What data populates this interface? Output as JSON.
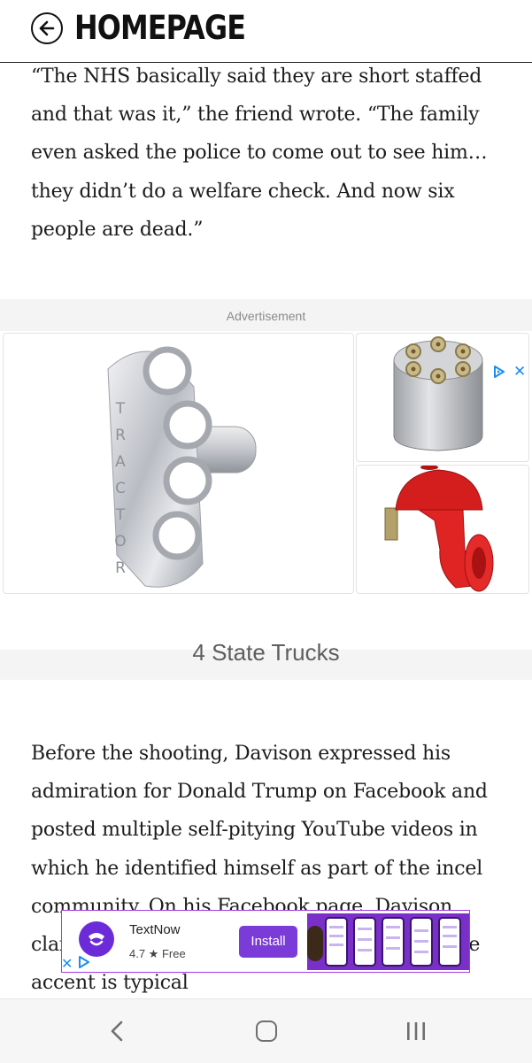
{
  "header": {
    "back_icon": "arrow-left-circle-icon",
    "title": "HOMEPAGE"
  },
  "article": {
    "paragraph_1": "“The NHS basically said they are short staffed and that was it,” the friend wrote. “The family even asked the police to come out to see him… they didn’t do a welfare check. And now six people are dead.”",
    "paragraph_2": "Before the shooting, Davison expressed his admiration for Donald Trump on Facebook and posted multiple self-pitying YouTube videos in which he identified himself as part of the incel community. On his Facebook page, Davison claimed to be from Arizona, but his distinctive accent is typical"
  },
  "ad": {
    "label": "Advertisement",
    "brand": "4 State Trucks",
    "main_image_lettering": "TRACTOR",
    "ad_choices_icon": "ad-choices-icon",
    "close_icon": "close-icon",
    "accent_color": "#1b8df0"
  },
  "banner_ad": {
    "app_name": "TextNow",
    "rating": "4.7 ★ Free",
    "install_label": "Install",
    "logo_icon": "textnow-logo-icon",
    "brand_color": "#7b3bd9"
  },
  "navbar": {
    "back_icon": "chevron-left-icon",
    "home_icon": "home-icon",
    "recents_icon": "recent-apps-icon"
  }
}
